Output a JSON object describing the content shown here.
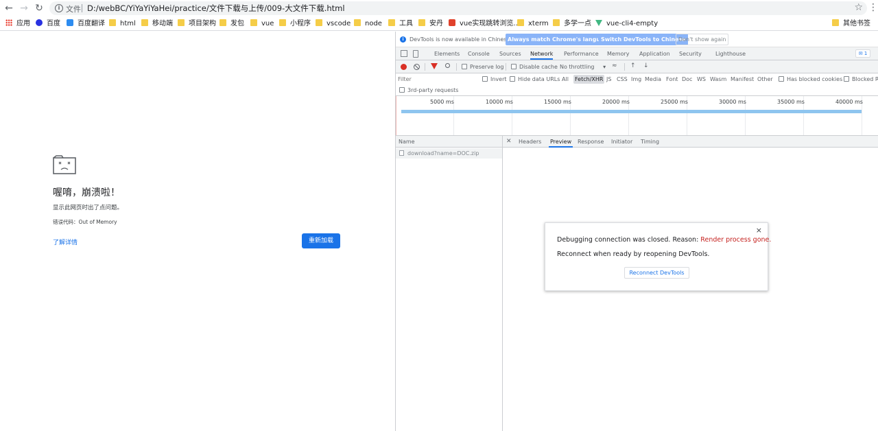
{
  "browser": {
    "url_scheme": "文件",
    "url": "D:/webBC/YiYaYiYaHei/practice/文件下载与上传/009-大文件下载.html"
  },
  "bookmarks": [
    {
      "label": "应用",
      "icon": "apps-grid-icon"
    },
    {
      "label": "百度",
      "icon": "baidu-icon"
    },
    {
      "label": "百度翻译",
      "icon": "baidu-translate-icon"
    },
    {
      "label": "html",
      "icon": "folder-icon"
    },
    {
      "label": "移动端",
      "icon": "folder-icon"
    },
    {
      "label": "项目架构",
      "icon": "folder-icon"
    },
    {
      "label": "发包",
      "icon": "folder-icon"
    },
    {
      "label": "vue",
      "icon": "folder-icon"
    },
    {
      "label": "小程序",
      "icon": "folder-icon"
    },
    {
      "label": "vscode",
      "icon": "folder-icon"
    },
    {
      "label": "node",
      "icon": "folder-icon"
    },
    {
      "label": "工具",
      "icon": "folder-icon"
    },
    {
      "label": "安丹",
      "icon": "folder-icon"
    },
    {
      "label": "vue实现跳转浏览...",
      "icon": "site-icon"
    },
    {
      "label": "xterm",
      "icon": "folder-icon"
    },
    {
      "label": "多学一点",
      "icon": "folder-icon"
    },
    {
      "label": "vue-cli4-empty",
      "icon": "vue-icon"
    },
    {
      "label": "其他书签",
      "icon": "folder-icon"
    }
  ],
  "crash": {
    "title": "喔唷，崩溃啦！",
    "description": "显示此网页时出了点问题。",
    "error_code": "错误代码：Out of Memory",
    "learn_more": "了解详情",
    "reload": "重新加载"
  },
  "devtools": {
    "infobar": {
      "text": "DevTools is now available in Chinese!",
      "btn_match": "Always match Chrome's language",
      "btn_switch": "Switch DevTools to Chinese",
      "btn_dont": "Don't show again"
    },
    "tabs": [
      "Elements",
      "Console",
      "Sources",
      "Network",
      "Performance",
      "Memory",
      "Application",
      "Security",
      "Lighthouse"
    ],
    "active_tab": "Network",
    "message_count": "1",
    "toolbar": {
      "preserve_log": "Preserve log",
      "disable_cache": "Disable cache",
      "throttling": "No throttling"
    },
    "filter": {
      "placeholder": "Filter",
      "invert": "Invert",
      "hide_data_urls": "Hide data URLs",
      "types": [
        "All",
        "Fetch/XHR",
        "JS",
        "CSS",
        "Img",
        "Media",
        "Font",
        "Doc",
        "WS",
        "Wasm",
        "Manifest",
        "Other"
      ],
      "active_type": "Fetch/XHR",
      "has_blocked_cookies": "Has blocked cookies",
      "blocked_requests": "Blocked R",
      "third_party": "3rd-party requests"
    },
    "timeline_ticks": [
      "5000 ms",
      "10000 ms",
      "15000 ms",
      "20000 ms",
      "25000 ms",
      "30000 ms",
      "35000 ms",
      "40000 ms"
    ],
    "requests": {
      "column_name": "Name",
      "rows": [
        "download?name=DOC.zip"
      ]
    },
    "detail_tabs": [
      "Headers",
      "Preview",
      "Response",
      "Initiator",
      "Timing"
    ],
    "active_detail_tab": "Preview",
    "dialog": {
      "message_prefix": "Debugging connection was closed. Reason: ",
      "reason": "Render process gone.",
      "message2": "Reconnect when ready by reopening DevTools.",
      "button": "Reconnect DevTools"
    }
  },
  "colors": {
    "accent": "#1a73e8",
    "record": "#d93025",
    "reason": "#c5221f",
    "timeline_bar": "#8ec5ef"
  }
}
